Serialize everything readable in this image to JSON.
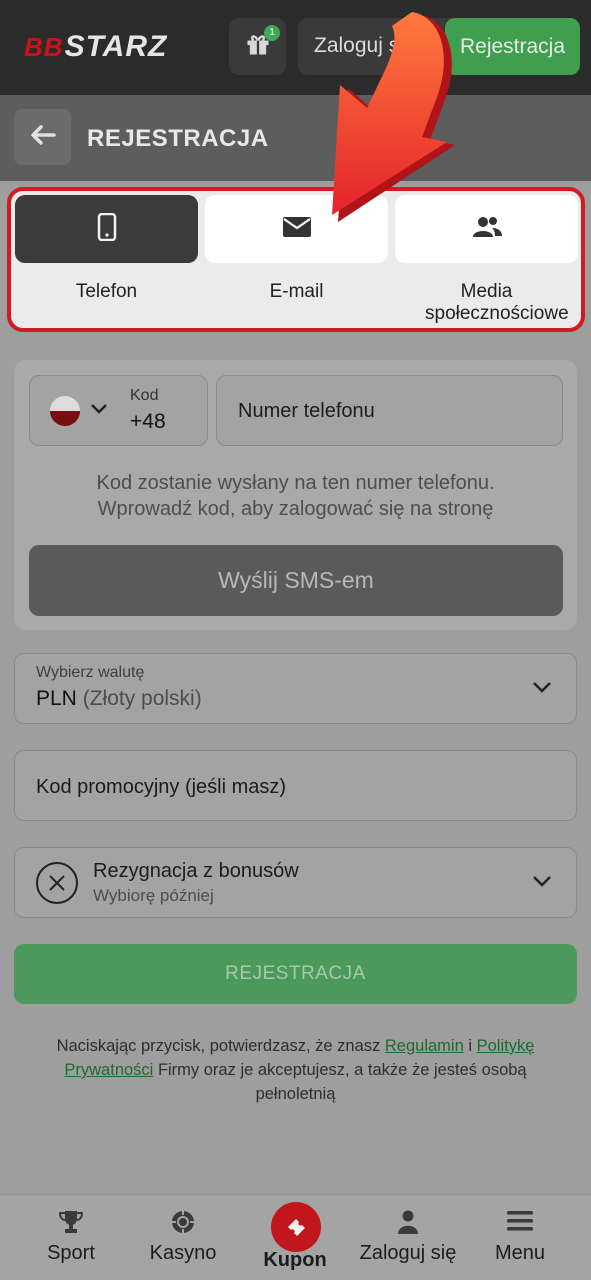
{
  "brand": {
    "prefix": "BB",
    "name": "STARZ"
  },
  "topbar": {
    "gift_badge": "1",
    "login_label": "Zaloguj się",
    "register_label": "Rejestracja"
  },
  "header": {
    "title": "REJESTRACJA"
  },
  "methods": [
    {
      "label": "Telefon",
      "icon": "phone-icon"
    },
    {
      "label": "E-mail",
      "icon": "envelope-icon"
    },
    {
      "label": "Media społecznościowe",
      "icon": "users-icon"
    }
  ],
  "phone": {
    "code_label": "Kod",
    "code_value": "+48",
    "placeholder": "Numer telefonu",
    "hint_line1": "Kod zostanie wysłany na ten numer telefonu.",
    "hint_line2": "Wprowadź kod, aby zalogować się na stronę",
    "sms_button": "Wyślij SMS-em"
  },
  "currency": {
    "label": "Wybierz walutę",
    "code": "PLN",
    "name": "(Złoty polski)"
  },
  "promo": {
    "placeholder": "Kod promocyjny (jeśli masz)"
  },
  "bonus": {
    "title": "Rezygnacja z bonusów",
    "subtitle": "Wybiorę później"
  },
  "register_button": "REJESTRACJA",
  "legal": {
    "part1": "Naciskając przycisk, potwierdzasz, że znasz",
    "link1": "Regulamin",
    "part2": "i",
    "link2": "Politykę Prywatności",
    "part3": "Firmy oraz je akceptujesz, a także że jesteś osobą pełnoletnią"
  },
  "nav": [
    {
      "label": "Sport",
      "icon": "trophy-icon"
    },
    {
      "label": "Kasyno",
      "icon": "casino-chip-icon"
    },
    {
      "label": "Kupon",
      "icon": "ticket-icon"
    },
    {
      "label": "Zaloguj się",
      "icon": "user-icon"
    },
    {
      "label": "Menu",
      "icon": "hamburger-icon"
    }
  ],
  "colors": {
    "accent_red": "#d01b22",
    "accent_green": "#3f9f4e",
    "highlight_arrow": "#f2462d"
  }
}
